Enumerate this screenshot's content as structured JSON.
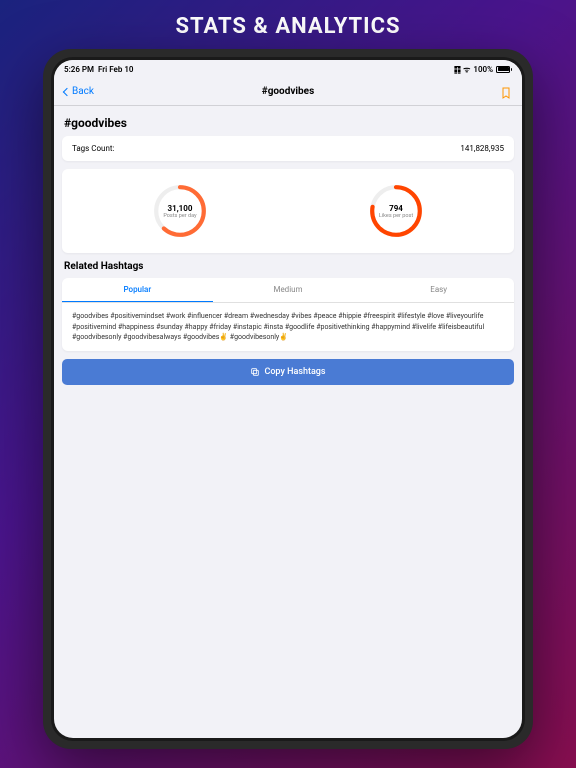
{
  "banner": "STATS & ANALYTICS",
  "statusbar": {
    "time": "5:26 PM",
    "date": "Fri Feb 10",
    "battery": "100%"
  },
  "nav": {
    "back": "Back",
    "title": "#goodvibes"
  },
  "heading": "#goodvibes",
  "tagsCount": {
    "label": "Tags Count:",
    "value": "141,828,935"
  },
  "gauge1": {
    "value": "31,100",
    "label": "Posts per day",
    "pct": 62
  },
  "gauge2": {
    "value": "794",
    "label": "Likes per post",
    "pct": 78
  },
  "relatedTitle": "Related Hashtags",
  "tabs": [
    "Popular",
    "Medium",
    "Easy"
  ],
  "hashtags": "#goodvibes #positivemindset #work #influencer #dream #wednesday #vibes #peace #hippie #freespirit #lifestyle #love #liveyourlife #positivemind #happiness #sunday #happy #friday #instapic #insta #goodlife #positivethinking #happymind #livelife #lifeisbeautiful #goodvibesonly #goodvibesalways #goodvibes✌ #goodvibesonly✌",
  "copyLabel": "Copy Hashtags"
}
